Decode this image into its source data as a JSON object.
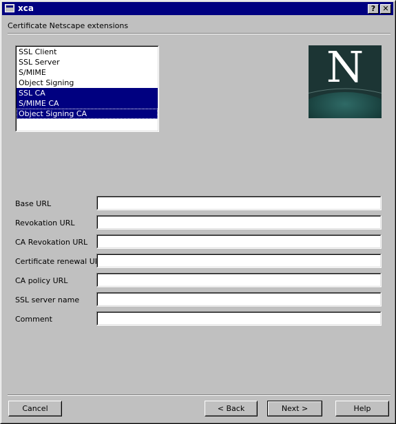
{
  "window": {
    "title": "xca"
  },
  "titlebar_buttons": {
    "help": "?",
    "close": "✕"
  },
  "page": {
    "heading": "Certificate Netscape extensions"
  },
  "cert_types": {
    "items": [
      {
        "label": "SSL Client",
        "selected": false
      },
      {
        "label": "SSL Server",
        "selected": false
      },
      {
        "label": "S/MIME",
        "selected": false
      },
      {
        "label": "Object Signing",
        "selected": false
      },
      {
        "label": "SSL CA",
        "selected": true
      },
      {
        "label": "S/MIME CA",
        "selected": true
      },
      {
        "label": "Object Signing CA",
        "selected": true,
        "focused": true
      }
    ]
  },
  "logo": {
    "letter": "N"
  },
  "fields": [
    {
      "label": "Base URL",
      "value": ""
    },
    {
      "label": "Revokation URL",
      "value": ""
    },
    {
      "label": "CA Revokation URL",
      "value": ""
    },
    {
      "label": "Certificate renewal URL",
      "value": ""
    },
    {
      "label": "CA policy URL",
      "value": ""
    },
    {
      "label": "SSL server name",
      "value": ""
    },
    {
      "label": "Comment",
      "value": ""
    }
  ],
  "buttons": {
    "cancel": "Cancel",
    "back": "< Back",
    "next": "Next >",
    "help": "Help"
  },
  "colors": {
    "titlebar": "#000080",
    "selection": "#000080",
    "face": "#c0c0c0"
  }
}
